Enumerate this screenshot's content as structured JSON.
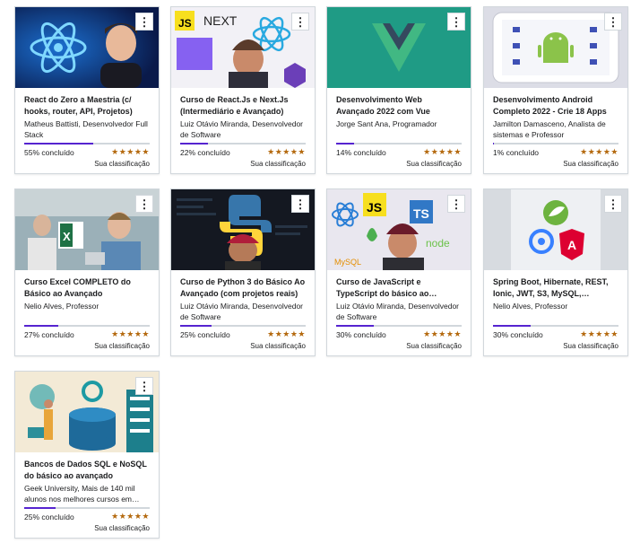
{
  "courses": [
    {
      "title": "React do Zero a Maestria (c/ hooks, router, API, Projetos)",
      "instructor": "Matheus Battisti, Desenvolvedor Full Stack",
      "progress_label": "55% concluído",
      "progress": 0.55,
      "rating_label": "Sua classificação",
      "stars": "★★★★★",
      "thumb_icon": "react-logo-with-presenter"
    },
    {
      "title": "Curso de React.Js e Next.Js (Intermediário e Avançado)",
      "instructor": "Luiz Otávio Miranda, Desenvolvedor de Software",
      "progress_label": "22% concluído",
      "progress": 0.22,
      "rating_label": "Sua classificação",
      "stars": "★★★★★",
      "thumb_icon": "js-next-react-logos"
    },
    {
      "title": "Desenvolvimento Web Avançado 2022 com Vue",
      "instructor": "Jorge Sant Ana, Programador",
      "progress_label": "14% concluído",
      "progress": 0.14,
      "rating_label": "Sua classificação",
      "stars": "★★★★★",
      "thumb_icon": "vue-logo"
    },
    {
      "title": "Desenvolvimento Android Completo 2022 - Crie 18 Apps",
      "instructor": "Jamilton Damasceno, Analista de sistemas e Professor",
      "progress_label": "1% concluído",
      "progress": 0.01,
      "rating_label": "Sua classificação",
      "stars": "★★★★★",
      "thumb_icon": "android-phone"
    },
    {
      "title": "Curso Excel COMPLETO do Básico ao Avançado",
      "instructor": "Nelio Alves, Professor",
      "progress_label": "27% concluído",
      "progress": 0.27,
      "rating_label": "Sua classificação",
      "stars": "★★★★★",
      "thumb_icon": "excel-office"
    },
    {
      "title": "Curso de Python 3 do Básico Ao Avançado (com projetos reais)",
      "instructor": "Luiz Otávio Miranda, Desenvolvedor de Software",
      "progress_label": "25% concluído",
      "progress": 0.25,
      "rating_label": "Sua classificação",
      "stars": "★★★★★",
      "thumb_icon": "python-logo"
    },
    {
      "title": "Curso de JavaScript e TypeScript do básico ao…",
      "instructor": "Luiz Otávio Miranda, Desenvolvedor de Software",
      "progress_label": "30% concluído",
      "progress": 0.3,
      "rating_label": "Sua classificação",
      "stars": "★★★★★",
      "thumb_icon": "js-ts-node-logos"
    },
    {
      "title": "Spring Boot, Hibernate, REST, Ionic, JWT, S3, MySQL,…",
      "instructor": "Nelio Alves, Professor",
      "progress_label": "30% concluído",
      "progress": 0.3,
      "rating_label": "Sua classificação",
      "stars": "★★★★★",
      "thumb_icon": "spring-angular-ionic"
    },
    {
      "title": "Bancos de Dados SQL e NoSQL do básico ao avançado",
      "instructor": "Geek University, Mais de 140 mil alunos nos melhores cursos em…",
      "progress_label": "25% concluído",
      "progress": 0.25,
      "rating_label": "Sua classificação",
      "stars": "★★★★★",
      "thumb_icon": "database-illustration"
    }
  ],
  "menu_glyph": "⋮",
  "colors": {
    "progress": "#5624d0",
    "stars": "#b4690e",
    "border": "#d1d7dc"
  }
}
